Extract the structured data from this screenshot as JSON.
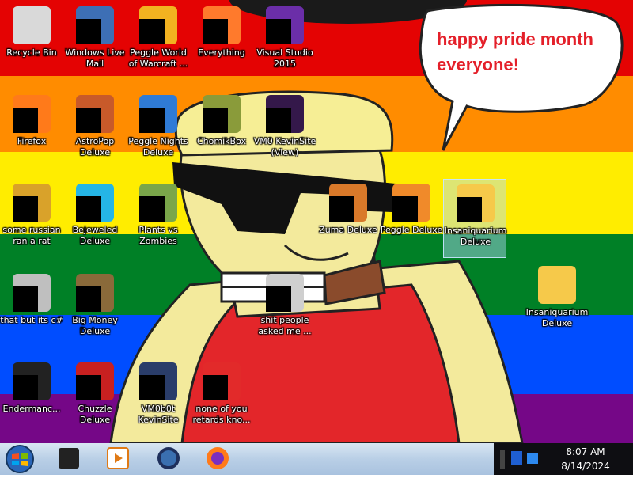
{
  "colors": {
    "stripes": [
      "#e40303",
      "#ff8c00",
      "#ffed00",
      "#008026",
      "#004dff",
      "#750787"
    ],
    "bubble_text": "#e4202a",
    "taskbar": "#b9cfe6",
    "tray": "#0e0e12"
  },
  "wallpaper": {
    "speech_bubble_text": "happy pride month everyone!"
  },
  "desktop_icons": [
    {
      "label": "Recycle Bin",
      "icon": "recycle-bin-icon"
    },
    {
      "label": "Windows Live Mail",
      "icon": "mail-icon"
    },
    {
      "label": "Peggle World of Warcraft ...",
      "icon": "peggle-icon"
    },
    {
      "label": "Everything",
      "icon": "search-icon"
    },
    {
      "label": "Visual Studio 2015",
      "icon": "visual-studio-icon"
    },
    {
      "label": "Firefox",
      "icon": "firefox-icon"
    },
    {
      "label": "AstroPop Deluxe",
      "icon": "astropop-icon"
    },
    {
      "label": "Peggle Nights Deluxe",
      "icon": "peggle-icon"
    },
    {
      "label": "ChomikBox",
      "icon": "chomikbox-icon"
    },
    {
      "label": "VM0 KevinSite (View)",
      "icon": "vm-icon"
    },
    {
      "label": "some russian ran a rat",
      "icon": "app-icon"
    },
    {
      "label": "Bejeweled Deluxe",
      "icon": "gem-icon"
    },
    {
      "label": "Plants vs Zombies",
      "icon": "plant-icon"
    },
    {
      "label": "Zuma Deluxe",
      "icon": "zuma-icon"
    },
    {
      "label": "Peggle Deluxe",
      "icon": "peggle-icon"
    },
    {
      "label": "Insaniquarium Deluxe",
      "icon": "fish-icon"
    },
    {
      "label": "that but its c#",
      "icon": "files-icon"
    },
    {
      "label": "Big Money Deluxe",
      "icon": "money-bag-icon"
    },
    {
      "label": "shit people asked me ...",
      "icon": "document-icon"
    },
    {
      "label": "Insaniquarium Deluxe",
      "icon": "fish-icon"
    },
    {
      "label": "Endermanc...",
      "icon": "terminal-icon"
    },
    {
      "label": "Chuzzle Deluxe",
      "icon": "chuzzle-icon"
    },
    {
      "label": "VM0b0t KevinSite",
      "icon": "vm-icon"
    },
    {
      "label": "none of you retards kno...",
      "icon": "app-icon"
    }
  ],
  "taskbar": {
    "pinned": [
      {
        "icon": "folder-icon"
      },
      {
        "icon": "media-player-icon"
      },
      {
        "icon": "globe-icon"
      },
      {
        "icon": "firefox-icon"
      }
    ],
    "clock_time": "8:07 AM",
    "clock_date": "8/14/2024"
  }
}
